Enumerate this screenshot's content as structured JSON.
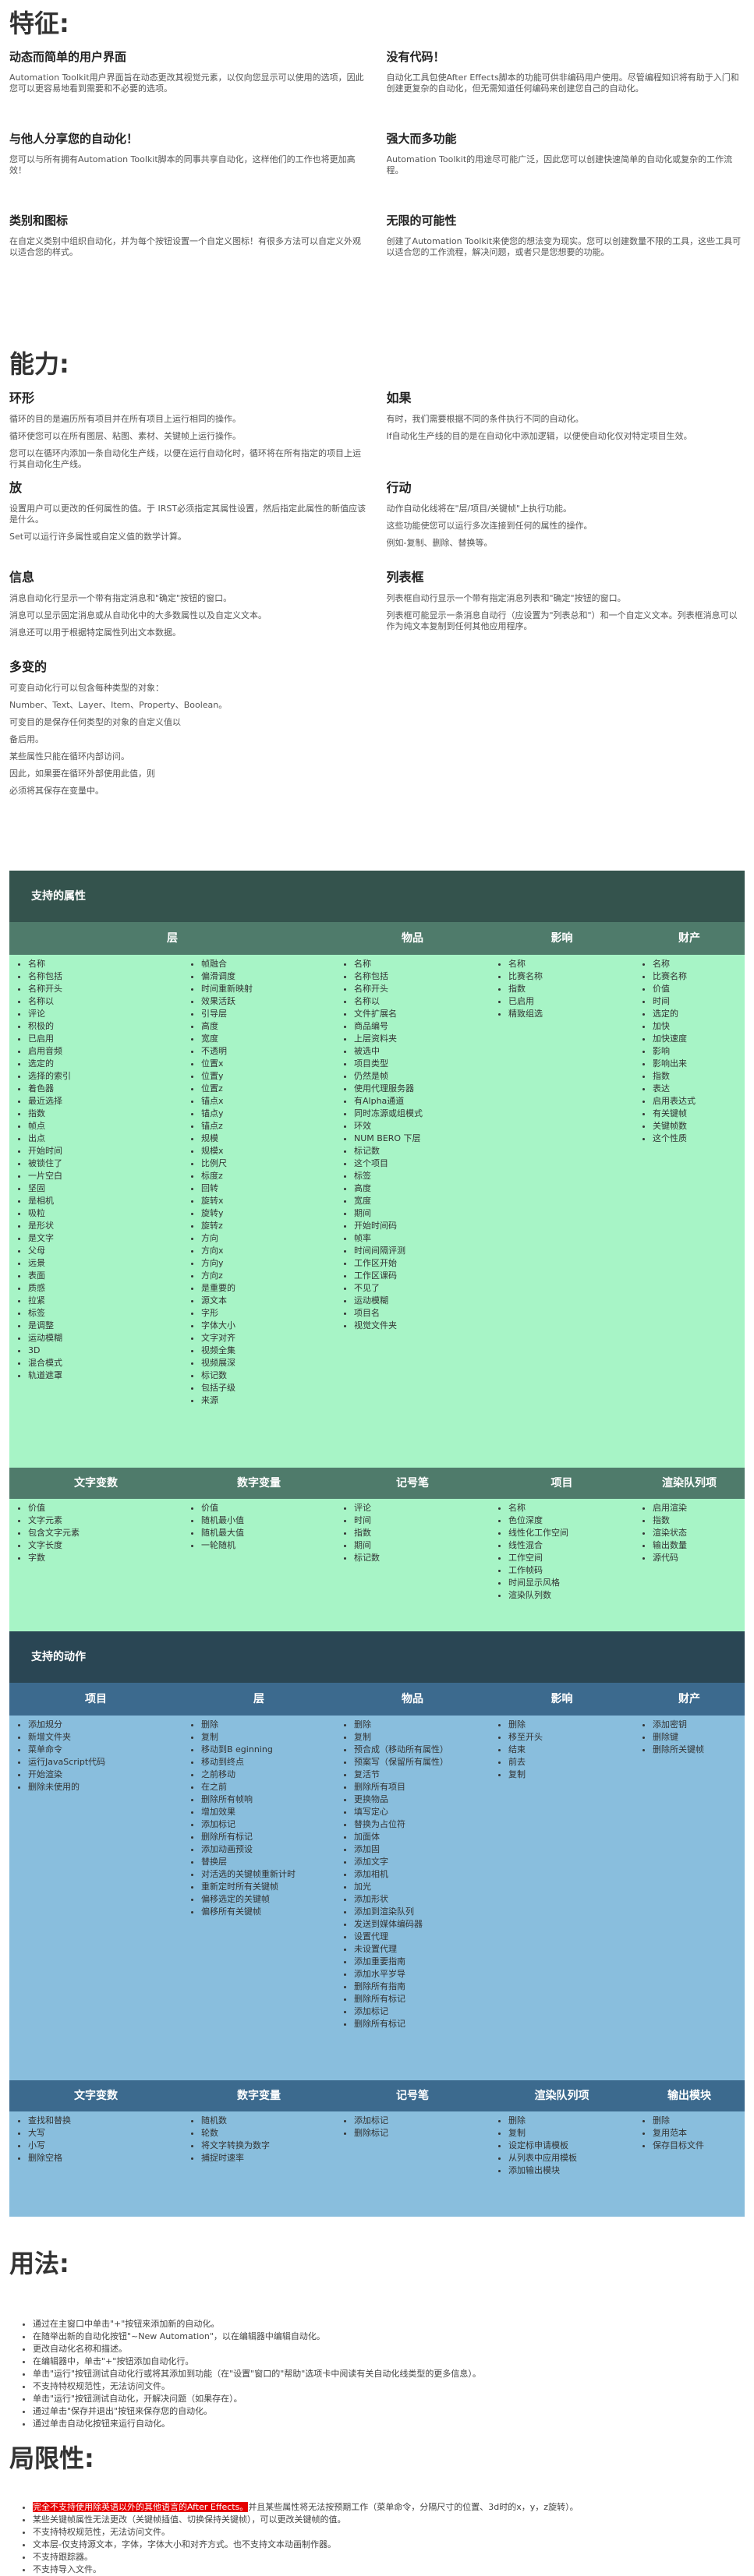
{
  "features": {
    "heading": "特征:",
    "items": [
      {
        "title": "动态而简单的用户界面",
        "text": "Automation Toolkit用户界面旨在动态更改其视觉元素，以仅向您显示可以使用的选项，因此您可以更容易地看到需要和不必要的选项。"
      },
      {
        "title": "没有代码！",
        "text": "自动化工具包使After Effects脚本的功能可供非编码用户使用。尽管编程知识将有助于入门和创建更复杂的自动化，但无需知道任何编码来创建您自己的自动化。"
      },
      {
        "title": "与他人分享您的自动化！",
        "text": "您可以与所有拥有Automation Toolkit脚本的同事共享自动化，这样他们的工作也将更加高效！"
      },
      {
        "title": "强大而多功能",
        "text": "Automation Toolkit的用途尽可能广泛，因此您可以创建快速简单的自动化或复杂的工作流程。"
      },
      {
        "title": "类别和图标",
        "text": "在自定义类别中组织自动化，并为每个按钮设置一个自定义图标！有很多方法可以自定义外观以适合您的样式。"
      },
      {
        "title": "无限的可能性",
        "text": "创建了Automation Toolkit来使您的想法变为现实。您可以创建数量不限的工具，这些工具可以适合您的工作流程，解决问题，或者只是您想要的功能。"
      }
    ]
  },
  "capabilities": {
    "heading": "能力:",
    "items": [
      {
        "title": "环形",
        "lines": [
          "循环的目的是遍历所有项目并在所有项目上运行相同的操作。",
          "循环使您可以在所有图层、粘图、素材、关键帧上运行操作。",
          "您可以在循环内添加一条自动化生产线，以便在运行自动化时，循环将在所有指定的项目上运行其自动化生产线。"
        ]
      },
      {
        "title": "如果",
        "lines": [
          "有时，我们需要根据不同的条件执行不同的自动化。",
          "If自动化生产线的目的是在自动化中添加逻辑，以便使自动化仅对特定项目生效。"
        ]
      },
      {
        "title": "放",
        "lines": [
          "设置用户可以更改的任何属性的值。于 IRST必须指定其属性设置，然后指定此属性的新值应该是什么。",
          "Set可以运行许多属性或自定义值的数学计算。"
        ]
      },
      {
        "title": "行动",
        "lines": [
          "动作自动化线将在\"层/项目/关键帧\"上执行功能。",
          "这些功能使您可以运行多次连接到任何的属性的操作。",
          "例如-复制、删除、替换等。"
        ]
      },
      {
        "title": "信息",
        "lines": [
          "消息自动化行显示一个带有指定消息和\"确定\"按钮的窗口。",
          "消息可以显示固定消息或从自动化中的大多数属性以及自定义文本。",
          "消息还可以用于根据特定属性列出文本数据。"
        ]
      },
      {
        "title": "列表框",
        "lines": [
          "列表框自动行显示一个带有指定消息列表和\"确定\"按钮的窗口。",
          "列表框可能显示一条消息自动行（应设置为\"列表总和\"）和一个自定义文本。列表框消息可以作为纯文本复制到任何其他应用程序。"
        ]
      }
    ],
    "variables": {
      "title": "多变的",
      "lines": [
        "可变自动化行可以包含每种类型的对象：",
        "Number、Text、Layer、Item、Property、Boolean。",
        "可变目的是保存任何类型的对象的自定义值以",
        "备后用。",
        "某些属性只能在循环内部访问。",
        "因此，如果要在循环外部使用此值，则",
        "必须将其保存在变量中。"
      ]
    }
  },
  "attributes": {
    "title": "支持的属性",
    "columns": [
      "层",
      "物品",
      "影响",
      "财产"
    ],
    "layer_a": [
      "名称",
      "名称包括",
      "名称开头",
      "名称以",
      "评论",
      "积极的",
      "已启用",
      "启用音频",
      "选定的",
      "选择的索引",
      "着色器",
      "最近选择",
      "指数",
      "帧点",
      "出点",
      "开始时间",
      "被锁住了",
      "一片空白",
      "坚固",
      "是相机",
      "吸粒",
      "是形状",
      "是文字",
      "父母",
      "远景",
      "表面",
      "质感",
      "拉紧",
      "标签",
      "是调整",
      "运动模糊",
      "3D",
      "混合模式",
      "轨道遮罩"
    ],
    "layer_b": [
      "帧融合",
      "偏滑调度",
      "时间重新映射",
      "效果活跃",
      "引导层",
      "高度",
      "宽度",
      "不透明",
      "位置x",
      "位置y",
      "位置z",
      "锚点x",
      "锚点y",
      "锚点z",
      "规模",
      "规模x",
      "比例尺",
      "标度z",
      "回转",
      "旋转x",
      "旋转y",
      "旋转z",
      "方向",
      "方向x",
      "方向y",
      "方向z",
      "是重要的",
      "源文本",
      "字形",
      "字体大小",
      "文字对齐",
      "视频全集",
      "视频展深",
      "标记数",
      "包括子级",
      "来源"
    ],
    "item": [
      "名称",
      "名称包括",
      "名称开头",
      "名称以",
      "文件扩展名",
      "商品编号",
      "上层资料夹",
      "被选中",
      "项目类型",
      "仍然是帧",
      "使用代理服务器",
      "有Alpha通道",
      "同时冻源或组模式",
      "环效",
      "NUM BERO 下层",
      "标记数",
      "这个项目",
      "标签",
      "高度",
      "宽度",
      "期间",
      "开始时间码",
      "帧率",
      "时间间隔评测",
      "工作区开始",
      "工作区课码",
      "不见了",
      "运动模糊",
      "项目名",
      "视觉文件夹"
    ],
    "effect": [
      "名称",
      "比赛名称",
      "指数",
      "已启用",
      "精致组选"
    ],
    "property": [
      "名称",
      "比赛名称",
      "价值",
      "时间",
      "选定的",
      "加快",
      "加快速度",
      "影响",
      "影响出来",
      "指数",
      "表达",
      "启用表达式",
      "有关键帧",
      "关键帧数",
      "这个性质"
    ],
    "lower_cols": [
      "文字变数",
      "数字变量",
      "记号笔",
      "项目",
      "渲染队列项"
    ],
    "text_var": [
      "价值",
      "文字元素",
      "包含文字元素",
      "文字长度",
      "字数"
    ],
    "num_var": [
      "价值",
      "随机最小值",
      "随机最大值",
      "一轮随机"
    ],
    "marker": [
      "评论",
      "时间",
      "指数",
      "期间",
      "标记数"
    ],
    "project": [
      "名称",
      "色位深度",
      "线性化工作空间",
      "线性混合",
      "工作空间",
      "工作帧码",
      "时间显示风格",
      "渲染队列数"
    ],
    "render": [
      "启用渲染",
      "指数",
      "渲染状态",
      "输出数量",
      "源代码"
    ]
  },
  "actions": {
    "title": "支持的动作",
    "columns": [
      "项目",
      "层",
      "物品",
      "影响",
      "财产"
    ],
    "project": [
      "添加规分",
      "新增文件夹",
      "菜单命令",
      "运行JavaScript代码",
      "开始渲染",
      "删除未使用的"
    ],
    "layer": [
      "删除",
      "复制",
      "移动到B eginning",
      "移动到终点",
      "之前移动",
      "在之前",
      "删除所有帧响",
      "增加效果",
      "添加标记",
      "删除所有标记",
      "添加动画预设",
      "替换层",
      "对活选的关键帧重新计时",
      "重新定时所有关键帧",
      "偏移选定的关键帧",
      "偏移所有关键帧"
    ],
    "item": [
      "删除",
      "复制",
      "预合成（移动所有属性）",
      "预案写（保留所有属性）",
      "复活节",
      "删除所有项目",
      "更换物品",
      "填写定心",
      "替换为占位符",
      "加面体",
      "添加固",
      "添加文字",
      "添加相机",
      "加光",
      "添加形状",
      "添加到渲染队列",
      "发送到媒体编码器",
      "设置代理",
      "未设置代理",
      "添加重要指南",
      "添加水平岁导",
      "删除所有指南",
      "删除所有标记",
      "添加标记",
      "删除所有标记"
    ],
    "effect": [
      "删除",
      "移至开头",
      "结束",
      "前去",
      "复制"
    ],
    "property": [
      "添加密钥",
      "删除键",
      "删除所关键帧"
    ],
    "lower_cols": [
      "文字变数",
      "数字变量",
      "记号笔",
      "渲染队列项",
      "输出模块"
    ],
    "text_var": [
      "查找和替换",
      "大写",
      "小写",
      "删除空格"
    ],
    "num_var": [
      "随机数",
      "轮数",
      "将文字转换为数字",
      "捕捉时速率"
    ],
    "marker": [
      "添加标记",
      "删除标记"
    ],
    "render": [
      "删除",
      "复制",
      "设定标申请模板",
      "从列表中应用模板",
      "添加输出模块"
    ],
    "output": [
      "删除",
      "复用范本",
      "保存目标文件"
    ]
  },
  "usage": {
    "heading": "用法:",
    "items": [
      "通过在主窗口中单击\"+\"按钮来添加新的自动化。",
      "在随举出新的自动化按钮\"~New Automation\"，以在编辑器中编辑自动化。",
      "更改自动化名称和描述。",
      "在编辑器中，单击\"+\"按钮添加自动化行。",
      "单击\"运行\"按钮测试自动化行或将其添加到功能（在\"设置\"窗口的\"帮助\"选项卡中阅读有关自动化线类型的更多信息）。",
      "不支持特权规范性，无法访问文件。",
      "单击\"运行\"按钮测试自动化，开解决问题（如果存在）。",
      "通过单击\"保存并退出\"按钮来保存您的自动化。",
      "通过单击自动化按钮来运行自动化。"
    ]
  },
  "limitations": {
    "heading": "局限性:",
    "items": [
      {
        "highlight": "完全不支持使用除英语以外的其他语言的After Effects。",
        "text": "并且某些属性将无法按预期工作（菜单命令，分隔尺寸的位置、3d时的x，y，z旋转）。"
      },
      {
        "highlight": "",
        "text": "某些关键帧属性无法更改（关键帧插值、切换保持关键帧），可以更改关键帧的值。"
      },
      {
        "highlight": "",
        "text": "不支持特权规范性，无法访问文件。"
      },
      {
        "highlight": "",
        "text": "文本层-仅支持源文本，字体，字体大小和对齐方式。也不支持文本动画制作器。"
      },
      {
        "highlight": "",
        "text": "不支持跟踪器。"
      },
      {
        "highlight": "",
        "text": "不支持导入文件。"
      }
    ]
  }
}
